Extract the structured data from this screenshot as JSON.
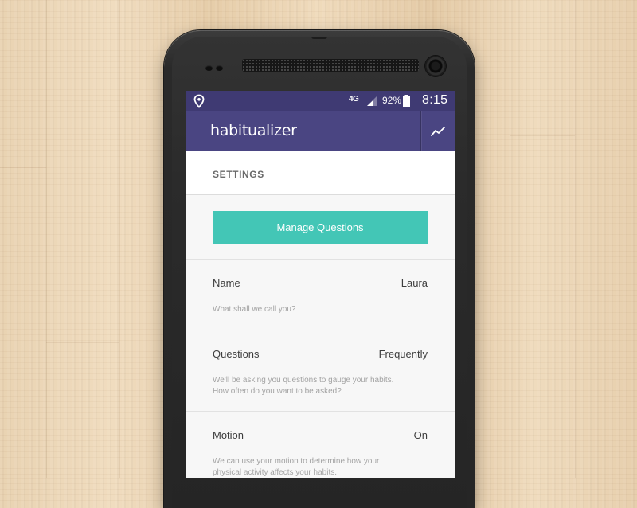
{
  "status_bar": {
    "network": "4G",
    "battery": "92%",
    "time": "8:15"
  },
  "app_bar": {
    "title": "habitualizer",
    "action_icon": "trend-chart-icon"
  },
  "settings": {
    "title": "SETTINGS",
    "manage_button": "Manage Questions",
    "rows": [
      {
        "label": "Name",
        "value": "Laura",
        "description": "What shall we call you?"
      },
      {
        "label": "Questions",
        "value": "Frequently",
        "description": "We'll be asking you questions to gauge your habits. How often do you want to be asked?"
      },
      {
        "label": "Motion",
        "value": "On",
        "description": "We can use your motion to determine how your physical activity affects your habits."
      }
    ]
  },
  "colors": {
    "status_bar": "#3f3a73",
    "app_bar": "#4a4582",
    "accent": "#43c6b6",
    "screen_bg": "#f7f7f7"
  }
}
